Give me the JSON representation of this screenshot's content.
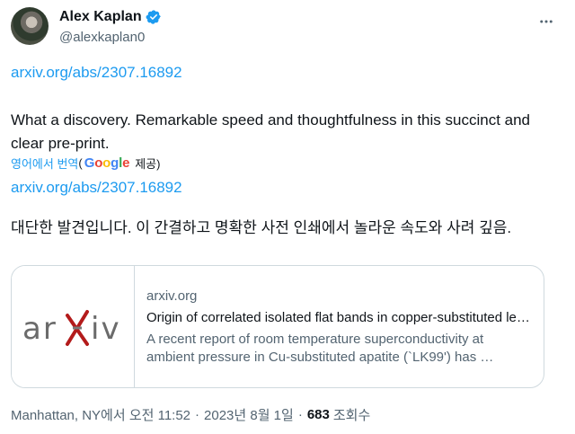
{
  "author": {
    "name": "Alex Kaplan",
    "handle": "@alexkaplan0"
  },
  "tweet": {
    "link_top": "arxiv.org/abs/2307.16892",
    "text": "What a discovery. Remarkable speed and thoughtfulness in this succinct and clear pre-print.",
    "translate_label": "영어에서 번역",
    "translate_open": "(",
    "google_word": "Google",
    "translate_provided": "제공)",
    "link_translated": "arxiv.org/abs/2307.16892",
    "translated_text": "대단한 발견입니다. 이 간결하고 명확한 사전 인쇄에서 놀라운 속도와 사려 깊음."
  },
  "card": {
    "logo_text": "arXiv",
    "domain": "arxiv.org",
    "title": "Origin of correlated isolated flat bands in copper-substituted lead phosphate apatite",
    "description": "A recent report of room temperature superconductivity at ambient pressure in Cu-substituted apatite (`LK99') has …"
  },
  "meta": {
    "location_time": "Manhattan, NY에서 오전 11:52",
    "separator": "·",
    "date": "2023년 8월 1일",
    "views_count": "683",
    "views_label": "조회수"
  },
  "colors": {
    "link": "#1d9bf0",
    "secondary_text": "#536471",
    "verified_badge": "#1d9bf0",
    "arxiv_red": "#b31b1b"
  },
  "icons": {
    "verified": "verified-badge-icon",
    "more": "more-dots-icon"
  }
}
